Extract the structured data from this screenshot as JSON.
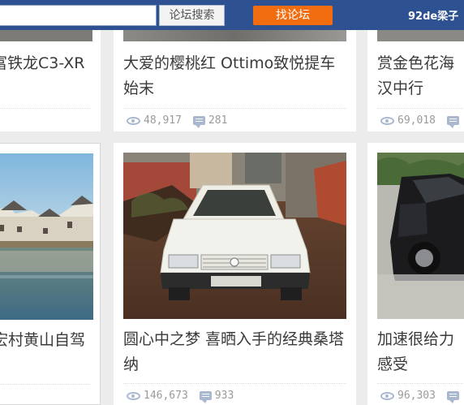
{
  "header": {
    "search_placeholder": "",
    "search_button": "论坛搜索",
    "find_button": "找论坛",
    "user": "92de梁子"
  },
  "cards": [
    {
      "title": "富铁龙C3-XR",
      "views": "",
      "replies": ""
    },
    {
      "title": "大爱的樱桃红 Ottimo致悦提车始末",
      "views": "48,917",
      "replies": "281"
    },
    {
      "title": "赏金色花海 汉中行",
      "views": "69,018",
      "replies": ""
    },
    {
      "title": "宏村黄山自驾",
      "views": "",
      "replies": ""
    },
    {
      "title": "圆心中之梦 喜晒入手的经典桑塔纳",
      "views": "146,673",
      "replies": "933"
    },
    {
      "title": "加速很给力 感受",
      "views": "96,303",
      "replies": ""
    }
  ],
  "colors": {
    "header_bg": "#2e5291",
    "find_button": "#f26d0f",
    "title_text": "#3a3a3a",
    "stat_text": "#9a9a9a"
  }
}
